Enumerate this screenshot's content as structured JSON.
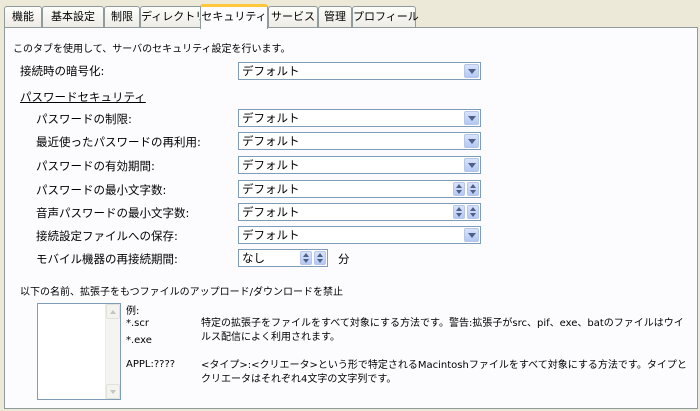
{
  "tabs": [
    {
      "label": "機能"
    },
    {
      "label": "基本設定"
    },
    {
      "label": "制限"
    },
    {
      "label": "ディレクトリ"
    },
    {
      "label": "セキュリティ"
    },
    {
      "label": "サービス"
    },
    {
      "label": "管理"
    },
    {
      "label": "プロフィール"
    }
  ],
  "active_tab": "セキュリティ",
  "intro": "このタブを使用して、サーバのセキュリティ設定を行います。",
  "encryption": {
    "label": "接続時の暗号化:",
    "value": "デフォルト"
  },
  "password_section": {
    "title": "パスワードセキュリティ"
  },
  "settings": [
    {
      "label": "パスワードの制限:",
      "value": "デフォルト"
    },
    {
      "label": "最近使ったパスワードの再利用:",
      "value": "デフォルト"
    },
    {
      "label": "パスワードの有効期間:",
      "value": "デフォルト"
    },
    {
      "label": "パスワードの最小文字数:",
      "value": "デフォルト"
    },
    {
      "label": "音声パスワードの最小文字数:",
      "value": "デフォルト"
    },
    {
      "label": "接続設定ファイルへの保存:",
      "value": "デフォルト"
    }
  ],
  "mobile": {
    "label": "モバイル機器の再接続期間:",
    "value": "なし",
    "unit": "分"
  },
  "blocked": {
    "label": "以下の名前、拡張子をもつファイルのアップロード/ダウンロードを禁止",
    "example_label": "例:",
    "ext1": "*.scr",
    "ext2": "*.exe",
    "ext_desc": "特定の拡張子をファイルをすべて対象にする方法です。警告:拡張子がsrc、pif、exe、batのファイルはウイルス配信によく利用されます。",
    "appl_label": "APPL:????",
    "appl_desc": "<タイプ>:<クリエータ>という形で特定されるMacintoshファイルをすべて対象にする方法です。タイプとクリエータはそれぞれ4文字の文字列です。"
  },
  "colors": {
    "tab_highlight": "#ffc83c",
    "window_bg": "#ece9d8",
    "panel_bg": "#fcfcfe"
  }
}
